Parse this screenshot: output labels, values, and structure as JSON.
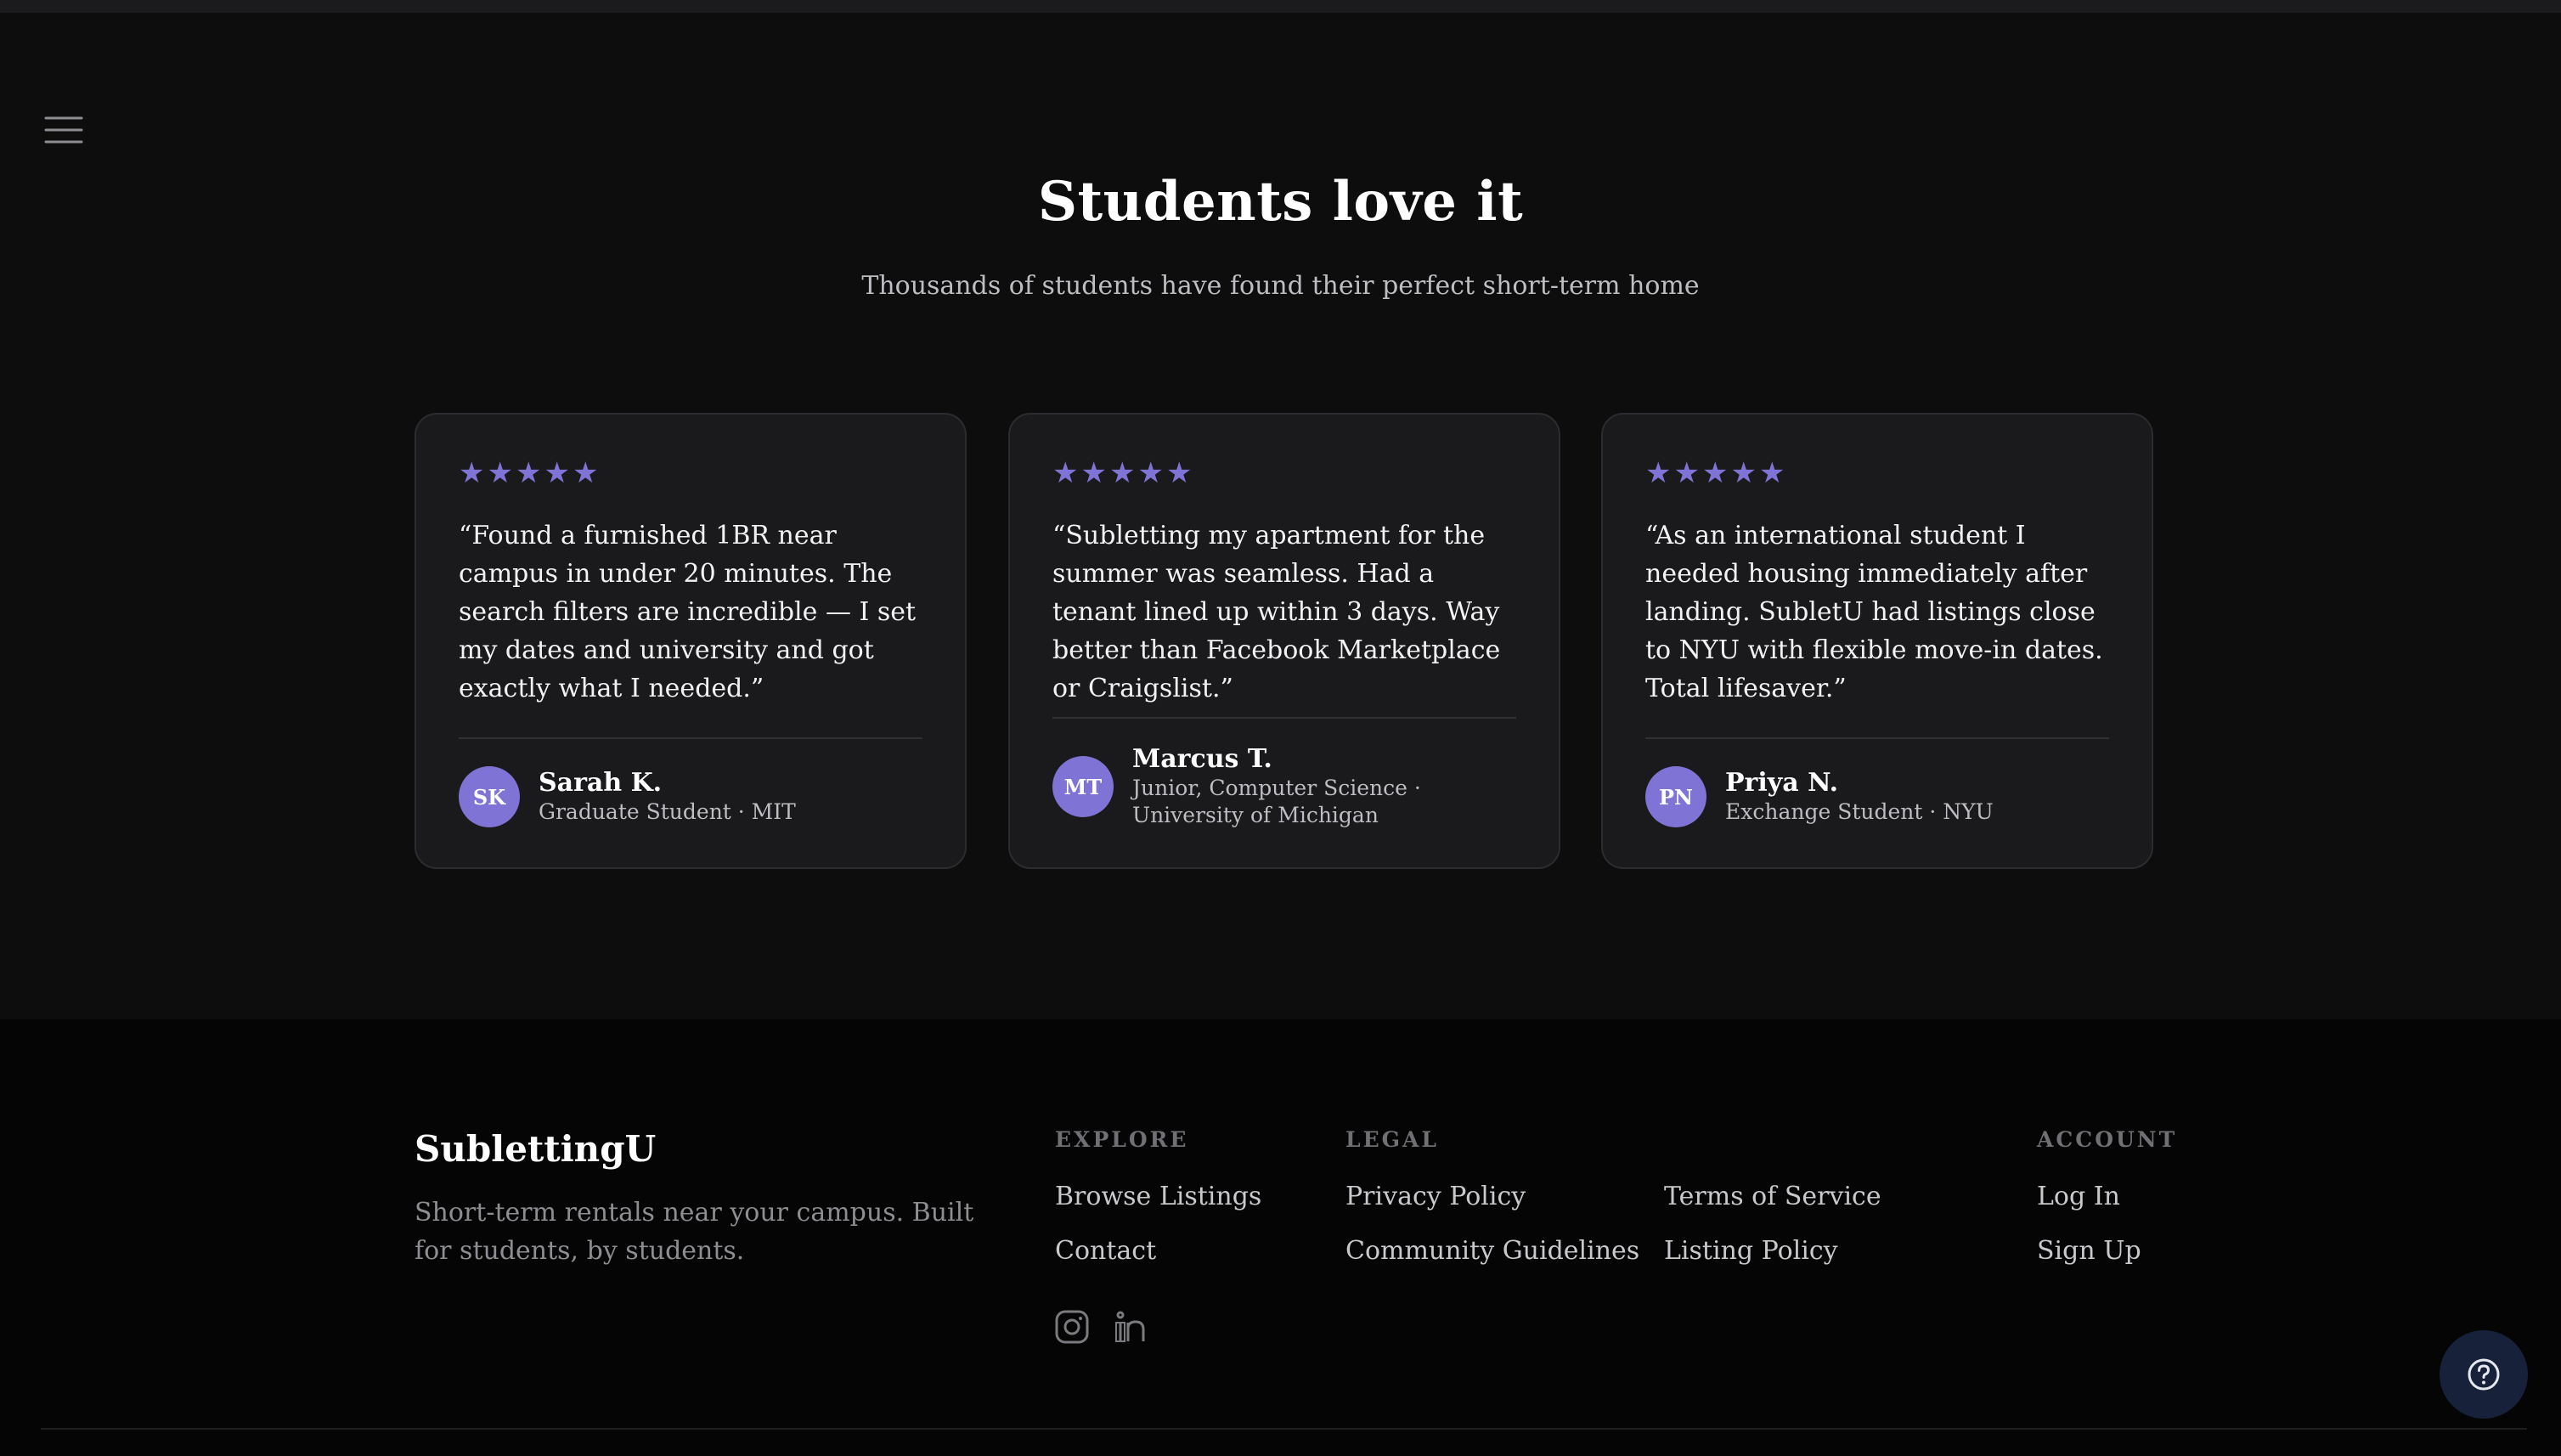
{
  "section": {
    "title": "Students love it",
    "subtitle": "Thousands of students have found their perfect short-term home"
  },
  "testimonials": [
    {
      "rating": 5,
      "quote": "“Found a furnished 1BR near campus in under 20 minutes. The search filters are incredible — I set my dates and university and got exactly what I needed.”",
      "initials": "SK",
      "name": "Sarah K.",
      "role": "Graduate Student · MIT"
    },
    {
      "rating": 5,
      "quote": "“Subletting my apartment for the summer was seamless. Had a tenant lined up within 3 days. Way better than Facebook Marketplace or Craigslist.”",
      "initials": "MT",
      "name": "Marcus T.",
      "role": "Junior, Computer Science · University of Michigan"
    },
    {
      "rating": 5,
      "quote": "“As an international student I needed housing immediately after landing. SubletU had listings close to NYU with flexible move-in dates. Total lifesaver.”",
      "initials": "PN",
      "name": "Priya N.",
      "role": "Exchange Student · NYU"
    }
  ],
  "footer": {
    "brand": "SublettingU",
    "description": "Short-term rentals near your campus. Built for students, by students.",
    "explore": {
      "heading": "EXPLORE",
      "links": [
        "Browse Listings",
        "Contact"
      ]
    },
    "legal": {
      "heading": "LEGAL",
      "links": [
        "Privacy Policy",
        "Community Guidelines",
        "Terms of Service",
        "Listing Policy"
      ]
    },
    "account": {
      "heading": "ACCOUNT",
      "links": [
        "Log In",
        "Sign Up"
      ]
    },
    "social_icons": [
      "instagram-icon",
      "linkedin-icon"
    ]
  },
  "icons": {
    "menu": "hamburger-menu-icon",
    "help": "help-circle-icon",
    "star": "★"
  },
  "colors": {
    "accent": "#7f74d6",
    "background": "#0d0d0e",
    "card": "#1a1a1c",
    "footer": "#050505",
    "help_button": "#17213a"
  }
}
